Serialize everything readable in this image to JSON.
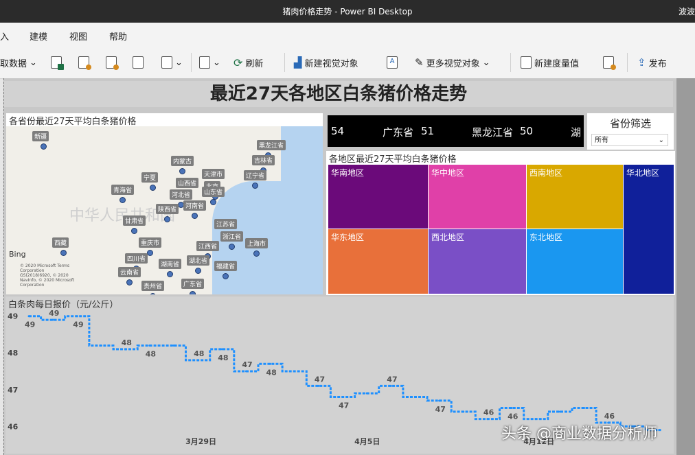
{
  "window": {
    "title": "猪肉价格走势 - Power BI Desktop",
    "user": "波波"
  },
  "menu": [
    "入",
    "建模",
    "视图",
    "帮助"
  ],
  "ribbon": {
    "get_data": "取数据",
    "refresh": "刷新",
    "new_visual": "新建视觉对象",
    "more_visuals": "更多视觉对象",
    "new_measure": "新建度量值",
    "publish": "发布"
  },
  "report": {
    "title": "最近27天各地区白条猪价格走势"
  },
  "map": {
    "title": "各省份最近27天平均白条猪价格",
    "country_label": "中华人民共和国",
    "bing": "Bing",
    "copyright": "© 2020 Microsoft Terms\nCorporation\nGS(2018)6920, © 2020\nNavInfo, © 2020 Microsoft\nCorporation",
    "provinces": [
      "新疆",
      "黑龙江省",
      "吉林省",
      "内蒙古",
      "辽宁省",
      "宁夏",
      "天津市",
      "北京",
      "山西省",
      "青海省",
      "河北省",
      "山东省",
      "陕西省",
      "河南省",
      "甘肃省",
      "江苏省",
      "浙江省",
      "上海市",
      "西藏",
      "重庆市",
      "江西省",
      "四川省",
      "湖南省",
      "湖北省",
      "福建省",
      "云南省",
      "贵州省",
      "广东省"
    ]
  },
  "ticker": {
    "items": [
      "54",
      "广东省",
      "51",
      "黑龙江省",
      "50",
      "湖"
    ]
  },
  "slicer": {
    "title": "省份筛选",
    "value": "所有"
  },
  "treemap": {
    "title": "各地区最近27天平均白条猪价格",
    "tiles": [
      {
        "label": "华南地区",
        "color": "#6b0a7a"
      },
      {
        "label": "华中地区",
        "color": "#e040a8"
      },
      {
        "label": "西南地区",
        "color": "#d9a800"
      },
      {
        "label": "华北地区",
        "color": "#10209a"
      },
      {
        "label": "华东地区",
        "color": "#e8703a"
      },
      {
        "label": "西北地区",
        "color": "#7a4fc6"
      },
      {
        "label": "东北地区",
        "color": "#1a97f0"
      }
    ]
  },
  "chart_data": {
    "type": "line",
    "title": "白条肉每日报价（元/公斤）",
    "color": "#1e90ff",
    "ylim": [
      45.8,
      49.2
    ],
    "yticks": [
      49,
      48,
      47,
      46
    ],
    "x": [
      "03-22",
      "03-23",
      "03-24",
      "03-25",
      "03-26",
      "03-27",
      "03-28",
      "03-29",
      "03-30",
      "03-31",
      "04-01",
      "04-02",
      "04-03",
      "04-04",
      "04-05",
      "04-06",
      "04-07",
      "04-08",
      "04-09",
      "04-10",
      "04-11",
      "04-12",
      "04-13",
      "04-14",
      "04-15",
      "04-16",
      "04-17"
    ],
    "values": [
      49.0,
      48.9,
      49.0,
      48.2,
      48.1,
      48.2,
      48.2,
      47.8,
      48.1,
      47.5,
      47.7,
      47.5,
      47.1,
      46.8,
      46.9,
      47.1,
      46.8,
      46.7,
      46.4,
      46.2,
      46.5,
      46.2,
      46.4,
      46.5,
      46.1,
      46.0,
      45.9
    ],
    "data_labels": [
      {
        "index": 0,
        "text": "49"
      },
      {
        "index": 1,
        "text": "49"
      },
      {
        "index": 2,
        "text": "49"
      },
      {
        "index": 4,
        "text": "48"
      },
      {
        "index": 5,
        "text": "48"
      },
      {
        "index": 7,
        "text": "48"
      },
      {
        "index": 8,
        "text": "48"
      },
      {
        "index": 9,
        "text": "47"
      },
      {
        "index": 10,
        "text": "48"
      },
      {
        "index": 12,
        "text": "47"
      },
      {
        "index": 13,
        "text": "47"
      },
      {
        "index": 15,
        "text": "47"
      },
      {
        "index": 17,
        "text": "47"
      },
      {
        "index": 19,
        "text": "46"
      },
      {
        "index": 20,
        "text": "46"
      },
      {
        "index": 24,
        "text": "46"
      }
    ],
    "xtick_labels": [
      {
        "index": 7,
        "text": "3月29日"
      },
      {
        "index": 14,
        "text": "4月5日"
      },
      {
        "index": 21,
        "text": "4月12日"
      }
    ]
  },
  "watermark": "头条 @商业数据分析师"
}
